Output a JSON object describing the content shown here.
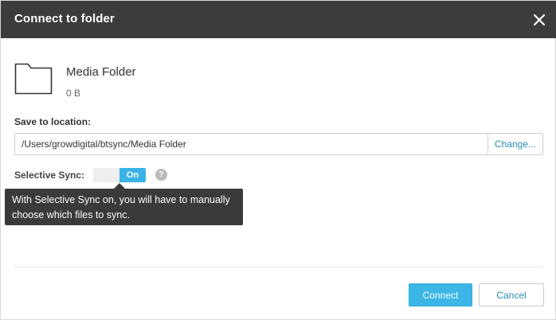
{
  "dialog": {
    "title": "Connect to folder",
    "close_icon": "close-icon"
  },
  "folder": {
    "icon": "folder-icon",
    "name": "Media Folder",
    "size": "0 B"
  },
  "save_location": {
    "label": "Save to location:",
    "value": "/Users/growdigital/btsync/Media Folder",
    "change_label": "Change..."
  },
  "selective_sync": {
    "label": "Selective Sync:",
    "toggle_on_label": "On",
    "state": "on",
    "help_icon": "help-icon",
    "help_glyph": "?",
    "tooltip": "With Selective Sync on, you will have to manually choose which files to sync."
  },
  "actions": {
    "connect_label": "Connect",
    "cancel_label": "Cancel"
  },
  "colors": {
    "titlebar": "#3c3c3c",
    "accent": "#3cb6e6",
    "link": "#2b8fb5",
    "tooltip": "#3a3a3a"
  }
}
